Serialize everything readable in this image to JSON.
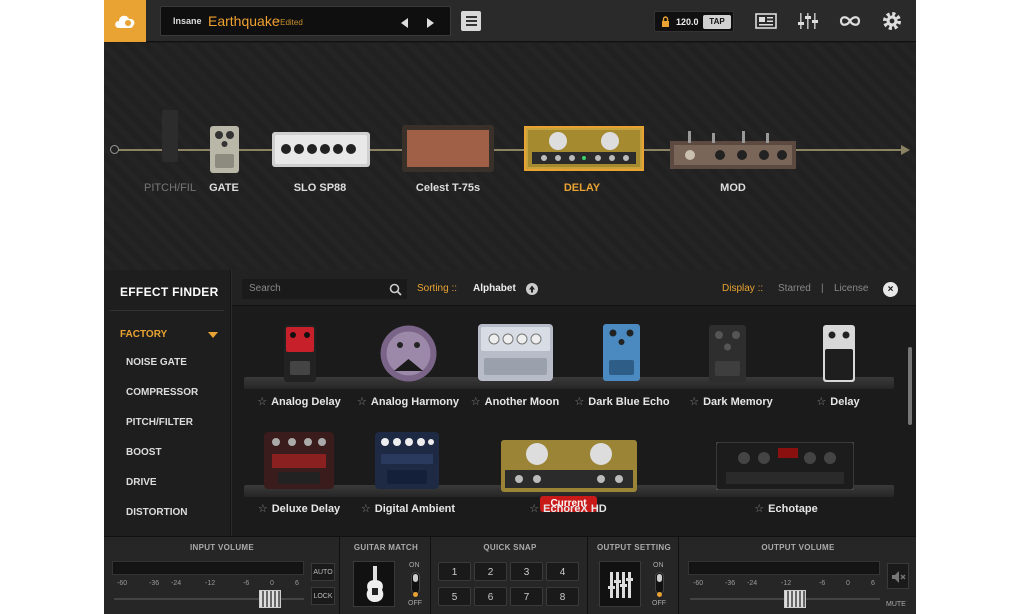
{
  "header": {
    "bank": "Insane",
    "preset_name": "Earthquake",
    "preset_status": "*Edited",
    "tempo": "120.0",
    "tap_label": "TAP"
  },
  "chain": {
    "slots": [
      {
        "label": "PITCH/FIL",
        "active": false
      },
      {
        "label": "GATE",
        "active": false
      },
      {
        "label": "SLO SP88",
        "active": false
      },
      {
        "label": "Celest T-75s",
        "active": false
      },
      {
        "label": "DELAY",
        "active": true
      },
      {
        "label": "MOD",
        "active": false
      }
    ]
  },
  "finder": {
    "title": "EFFECT FINDER",
    "category": "FACTORY",
    "items": [
      "NOISE GATE",
      "COMPRESSOR",
      "PITCH/FILTER",
      "BOOST",
      "DRIVE",
      "DISTORTION"
    ],
    "search_placeholder": "Search",
    "sorting_label": "Sorting ::",
    "sorting_value": "Alphabet",
    "display_label": "Display ::",
    "display_options": [
      "Starred",
      "|",
      "License"
    ],
    "close_label": "×",
    "current_badge": "Current",
    "row1": [
      "Analog Delay",
      "Analog Harmony",
      "Another Moon",
      "Dark Blue Echo",
      "Dark Memory",
      "Delay"
    ],
    "row2": [
      "Deluxe Delay",
      "Digital Ambient",
      "EchoreX HD",
      "Echotape"
    ]
  },
  "bottom": {
    "input_volume": "INPUT VOLUME",
    "guitar_match": "GUITAR MATCH",
    "quick_snap": "QUICK SNAP",
    "output_setting": "OUTPUT SETTING",
    "output_volume": "OUTPUT VOLUME",
    "auto": "AUTO",
    "lock": "LOCK",
    "mute": "MUTE",
    "on": "ON",
    "off": "OFF",
    "scale": [
      "-60",
      "-36",
      "-24",
      "-12",
      "-6",
      "0",
      "6"
    ],
    "snaps": [
      "1",
      "2",
      "3",
      "4",
      "5",
      "6",
      "7",
      "8"
    ]
  },
  "colors": {
    "accent": "#e8a332",
    "current": "#c91a1a"
  }
}
